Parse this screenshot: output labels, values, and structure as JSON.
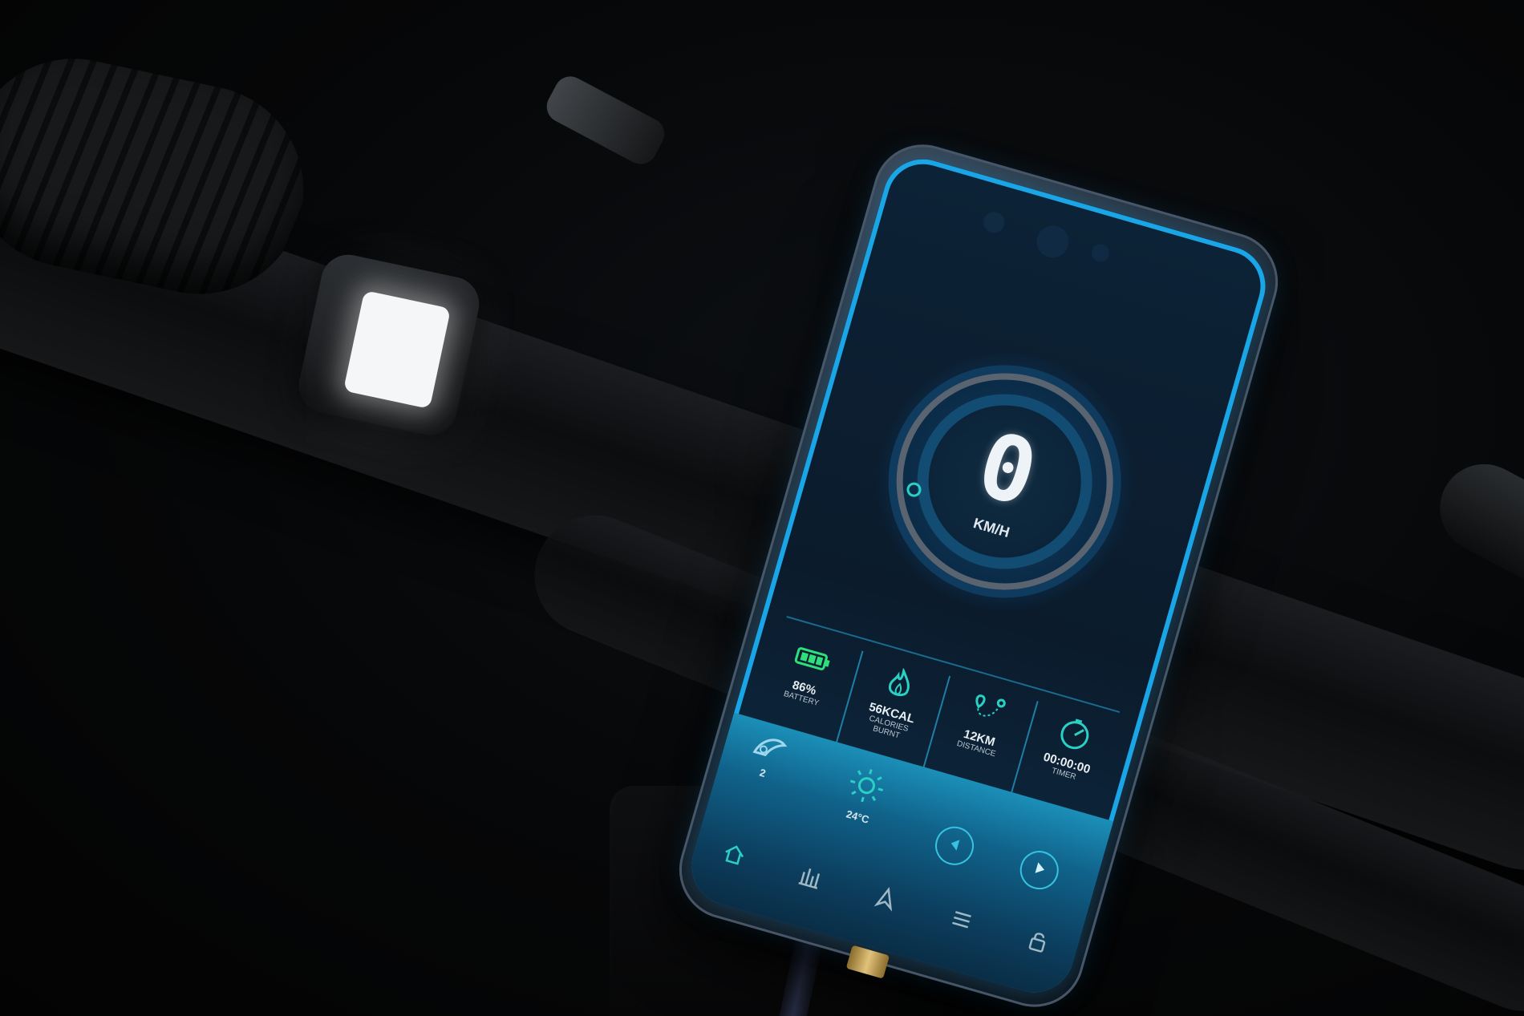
{
  "speedometer": {
    "value": "0",
    "unit": "KM/H"
  },
  "stats": [
    {
      "value": "86%",
      "label": "BATTERY",
      "icon": "battery-icon"
    },
    {
      "value": "56KCAL",
      "label": "CALORIES BURNT",
      "icon": "flame-icon"
    },
    {
      "value": "12KM",
      "label": "DISTANCE",
      "icon": "route-icon"
    },
    {
      "value": "00:00:00",
      "label": "TIMER",
      "icon": "stopwatch-icon"
    }
  ],
  "assist": {
    "value": "2",
    "icon": "assist-level-icon"
  },
  "weather": {
    "value": "24°C",
    "icon": "sun-icon"
  },
  "nav": [
    "home-icon",
    "stats-icon",
    "navigation-icon",
    "menu-icon",
    "lock-icon"
  ],
  "colors": {
    "accent": "#1aa6e6",
    "teal": "#2ad0c4",
    "battery": "#2fe07a",
    "screen_bg": "#0b1b2c"
  }
}
